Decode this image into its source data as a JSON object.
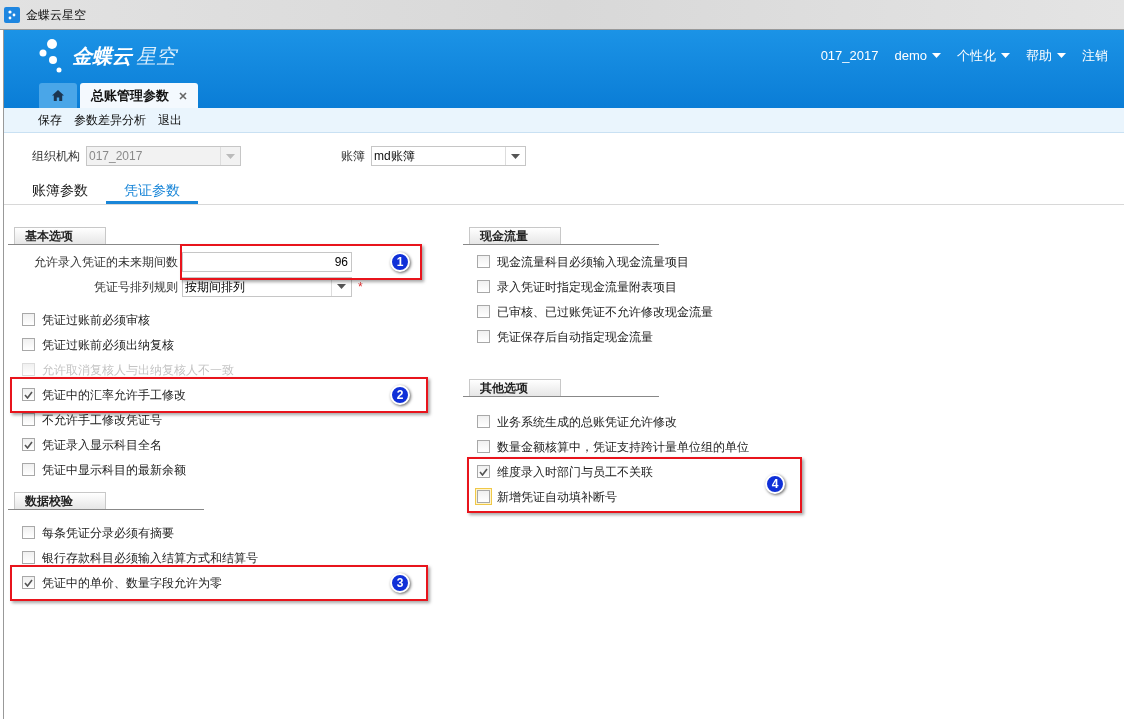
{
  "window": {
    "title": "金蝶云星空"
  },
  "header": {
    "logo_text": "金蝶云",
    "logo_sub": "星空",
    "menu": [
      {
        "label": "017_2017",
        "dropdown": false
      },
      {
        "label": "demo",
        "dropdown": true
      },
      {
        "label": "个性化",
        "dropdown": true
      },
      {
        "label": "帮助",
        "dropdown": true
      },
      {
        "label": "注销",
        "dropdown": false
      }
    ]
  },
  "doc_tabs": [
    {
      "kind": "home",
      "selected": false
    },
    {
      "kind": "page",
      "label": "总账管理参数",
      "closable": true,
      "selected": true
    }
  ],
  "toolbar": [
    "保存",
    "参数差异分析",
    "退出"
  ],
  "filters": [
    {
      "label": "组织机构",
      "value": "017_2017",
      "disabled": true
    },
    {
      "label": "账簿",
      "value": "md账簿",
      "disabled": false
    }
  ],
  "tabs": [
    {
      "label": "账簿参数",
      "selected": false
    },
    {
      "label": "凭证参数",
      "selected": true
    }
  ],
  "left_sections": [
    {
      "title": "基本选项",
      "fields": [
        {
          "kind": "number",
          "label": "允许录入凭证的未来期间数",
          "value": "96",
          "callout": "1"
        },
        {
          "kind": "select",
          "label": "凭证号排列规则",
          "value": "按期间排列",
          "required": "*"
        }
      ],
      "items": [
        {
          "kind": "checkbox",
          "label": "凭证过账前必须审核",
          "checked": false,
          "disabled": false,
          "focused": false
        },
        {
          "kind": "checkbox",
          "label": "凭证过账前必须出纳复核",
          "checked": false,
          "disabled": false,
          "focused": false
        },
        {
          "kind": "checkbox",
          "label": "允许取消复核人与出纳复核人不一致",
          "checked": false,
          "disabled": true,
          "focused": false
        },
        {
          "kind": "callout",
          "number": "2",
          "items": [
            {
              "kind": "checkbox",
              "label": "凭证中的汇率允许手工修改",
              "checked": true,
              "disabled": false,
              "focused": false
            }
          ]
        },
        {
          "kind": "checkbox",
          "label": "不允许手工修改凭证号",
          "checked": false,
          "disabled": false,
          "focused": false
        },
        {
          "kind": "checkbox",
          "label": "凭证录入显示科目全名",
          "checked": true,
          "disabled": false,
          "focused": false
        },
        {
          "kind": "checkbox",
          "label": "凭证中显示科目的最新余额",
          "checked": false,
          "disabled": false,
          "focused": false
        }
      ]
    },
    {
      "title": "数据校验",
      "items": [
        {
          "kind": "checkbox",
          "label": "每条凭证分录必须有摘要",
          "checked": false,
          "disabled": false,
          "focused": false
        },
        {
          "kind": "checkbox",
          "label": "银行存款科目必须输入结算方式和结算号",
          "checked": false,
          "disabled": false,
          "focused": false
        },
        {
          "kind": "callout",
          "number": "3",
          "items": [
            {
              "kind": "checkbox",
              "label": "凭证中的单价、数量字段允许为零",
              "checked": true,
              "disabled": false,
              "focused": false
            }
          ]
        }
      ]
    }
  ],
  "right_sections": [
    {
      "title": "现金流量",
      "items": [
        {
          "kind": "checkbox",
          "label": "现金流量科目必须输入现金流量项目",
          "checked": false,
          "disabled": false,
          "focused": false
        },
        {
          "kind": "checkbox",
          "label": "录入凭证时指定现金流量附表项目",
          "checked": false,
          "disabled": false,
          "focused": false
        },
        {
          "kind": "checkbox",
          "label": "已审核、已过账凭证不允许修改现金流量",
          "checked": false,
          "disabled": false,
          "focused": false
        },
        {
          "kind": "checkbox",
          "label": "凭证保存后自动指定现金流量",
          "checked": false,
          "disabled": false,
          "focused": false
        }
      ]
    },
    {
      "title": "其他选项",
      "items": [
        {
          "kind": "checkbox",
          "label": "业务系统生成的总账凭证允许修改",
          "checked": false,
          "disabled": false,
          "focused": false
        },
        {
          "kind": "checkbox",
          "label": "数量金额核算中，凭证支持跨计量单位组的单位",
          "checked": false,
          "disabled": false,
          "focused": false
        },
        {
          "kind": "callout",
          "number": "4",
          "items": [
            {
              "kind": "checkbox",
              "label": "维度录入时部门与员工不关联",
              "checked": true,
              "disabled": false,
              "focused": false
            },
            {
              "kind": "checkbox",
              "label": "新增凭证自动填补断号",
              "checked": false,
              "disabled": false,
              "focused": true
            }
          ]
        }
      ]
    }
  ]
}
